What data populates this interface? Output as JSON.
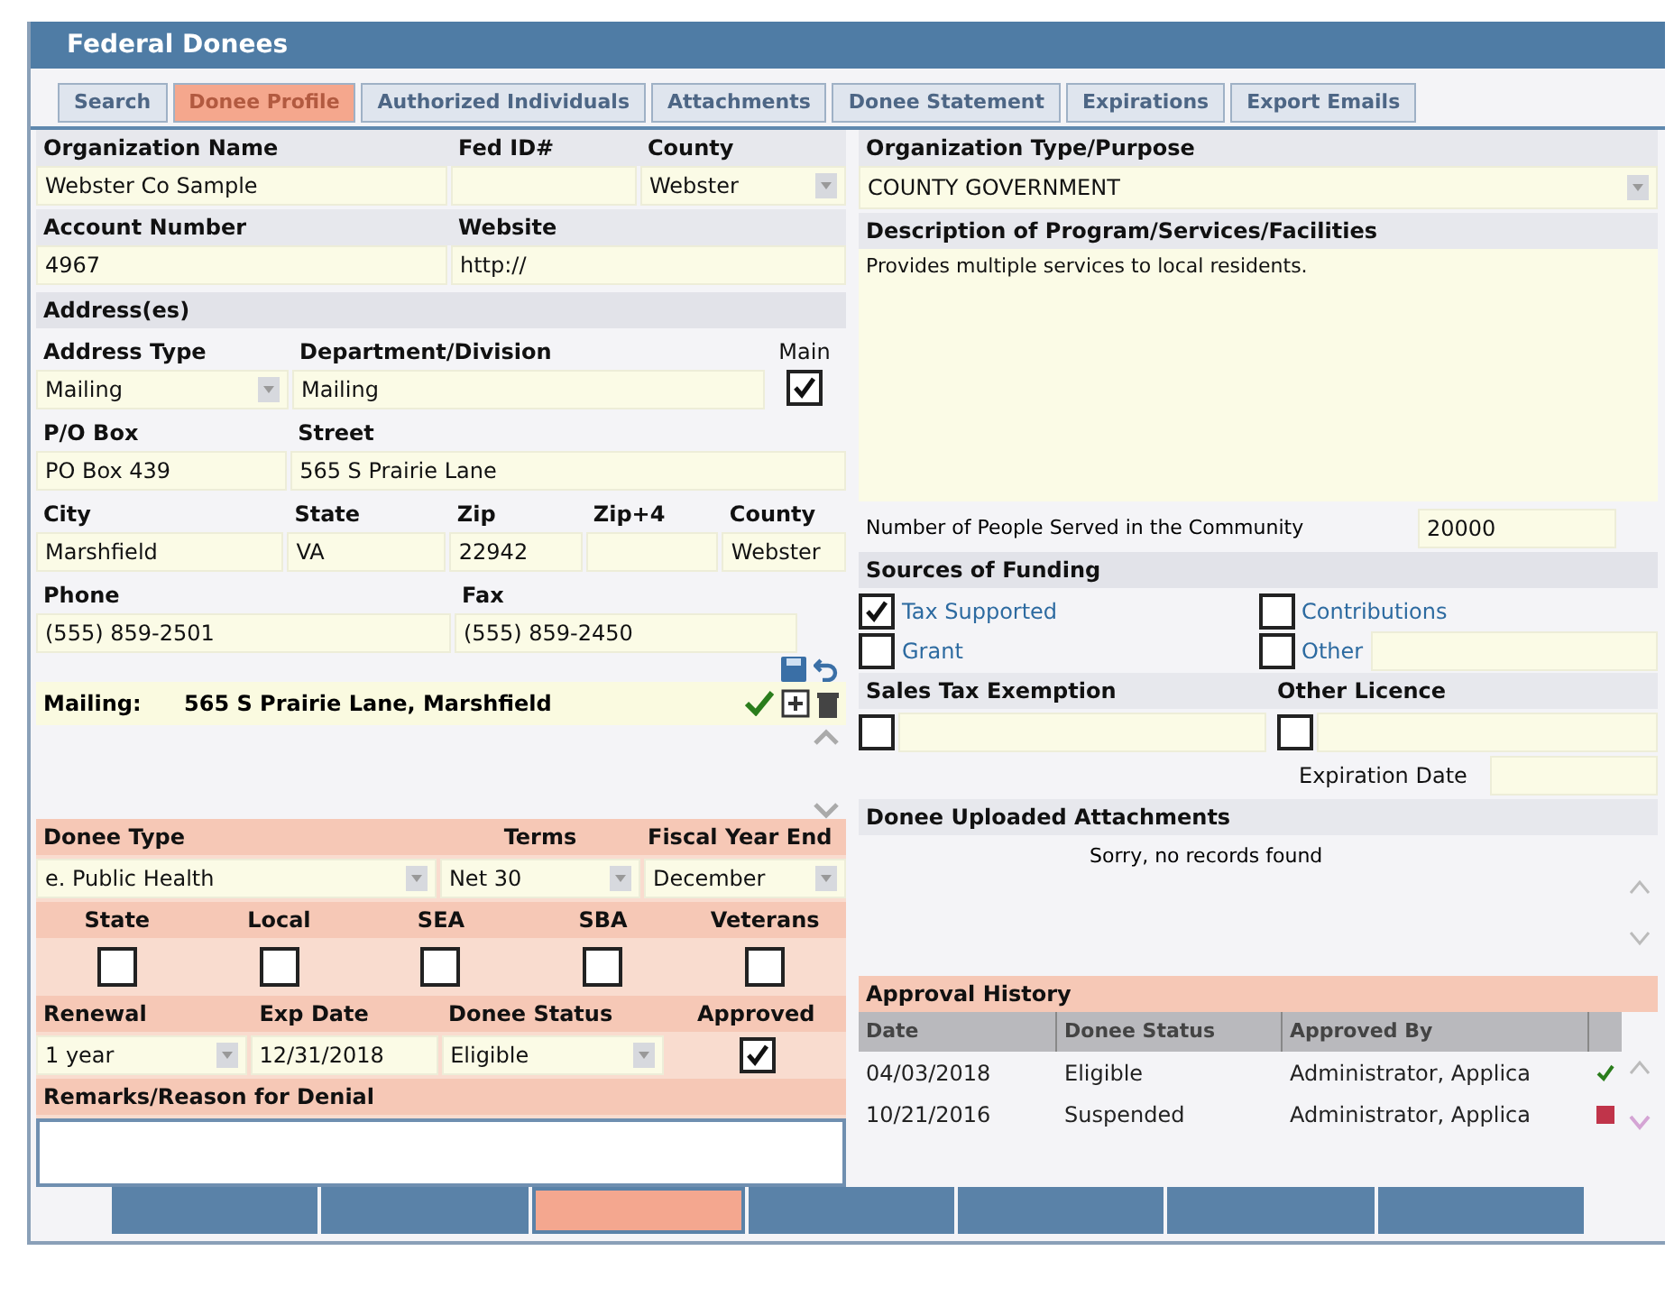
{
  "window": {
    "title": "Federal Donees"
  },
  "tabs": [
    {
      "label": "Search",
      "selected": false
    },
    {
      "label": "Donee Profile",
      "selected": true
    },
    {
      "label": "Authorized Individuals",
      "selected": false
    },
    {
      "label": "Attachments",
      "selected": false
    },
    {
      "label": "Donee Statement",
      "selected": false
    },
    {
      "label": "Expirations",
      "selected": false
    },
    {
      "label": "Export Emails",
      "selected": false
    }
  ],
  "organization": {
    "name_label": "Organization Name",
    "name": "Webster Co Sample",
    "fed_id_label": "Fed ID#",
    "county_label": "County",
    "county": "Webster",
    "account_label": "Account Number",
    "account": "4967",
    "website_label": "Website",
    "website": "http://"
  },
  "address": {
    "heading": "Address(es)",
    "rows": [
      [
        {
          "label": "Address Type",
          "value": "Mailing",
          "kind": "select"
        },
        {
          "label": "Department/Division",
          "value": "Mailing",
          "kind": "text"
        }
      ],
      [
        {
          "label": "P/O Box",
          "value": "PO Box 439",
          "kind": "text"
        },
        {
          "label": "Street",
          "value": "565 S Prairie Lane",
          "kind": "text"
        }
      ],
      [
        {
          "label": "City",
          "value": "Marshfield",
          "kind": "text"
        },
        {
          "label": "State",
          "value": "VA",
          "kind": "text"
        },
        {
          "label": "Zip",
          "value": "22942",
          "kind": "text"
        },
        {
          "label": "Zip+4",
          "kind": "text"
        },
        {
          "label": "County",
          "value": "Webster",
          "kind": "text"
        }
      ],
      [
        {
          "label": "Phone",
          "value": "(555) 859-2501",
          "kind": "text"
        },
        {
          "label": "Fax",
          "value": "(555) 859-2450",
          "kind": "text"
        }
      ]
    ],
    "main": {
      "label": "Main",
      "checked": true
    },
    "mailing": {
      "label": "Mailing:",
      "value": "565 S Prairie Lane, Marshfield",
      "verified": true
    }
  },
  "donee": {
    "type_label": "Donee Type",
    "type": "e. Public Health",
    "terms_label": "Terms",
    "terms": "Net 30",
    "fiscal_label": "Fiscal Year End",
    "fiscal": "December",
    "programs": [
      {
        "label": "State",
        "checked": false
      },
      {
        "label": "Local",
        "checked": false
      },
      {
        "label": "SEA",
        "checked": false
      },
      {
        "label": "SBA",
        "checked": false
      },
      {
        "label": "Veterans",
        "checked": false
      }
    ],
    "renewal_label": "Renewal",
    "renewal": "1 year",
    "exp_label": "Exp Date",
    "exp": "12/31/2018",
    "status_label": "Donee Status",
    "status": "Eligible",
    "approved_label": "Approved",
    "approved": true,
    "remarks_label": "Remarks/Reason for Denial"
  },
  "org_type": {
    "label": "Organization Type/Purpose",
    "value": "COUNTY GOVERNMENT"
  },
  "description": {
    "label": "Description of Program/Services/Facilities",
    "value": "Provides multiple services to local residents."
  },
  "people_served": {
    "label": "Number of People Served in the Community",
    "value": "20000"
  },
  "funding": {
    "heading": "Sources of Funding",
    "options": [
      {
        "label": "Tax Supported",
        "checked": true
      },
      {
        "label": "Contributions",
        "checked": false
      },
      {
        "label": "Grant",
        "checked": false
      },
      {
        "label": "Other",
        "checked": false
      }
    ]
  },
  "sales_tax": {
    "label": "Sales Tax Exemption",
    "checked": false
  },
  "other_licence": {
    "label": "Other Licence",
    "checked": false,
    "expiration_label": "Expiration Date"
  },
  "attachments": {
    "heading": "Donee Uploaded Attachments",
    "empty": "Sorry, no records found"
  },
  "approval": {
    "heading": "Approval History",
    "columns": [
      "Date",
      "Donee Status",
      "Approved By"
    ],
    "rows": [
      {
        "date": "04/03/2018",
        "status": "Eligible",
        "approved_by": "Administrator, Applica",
        "kind": "approved"
      },
      {
        "date": "10/21/2016",
        "status": "Suspended",
        "approved_by": "Administrator, Applica",
        "kind": "rejected"
      }
    ]
  },
  "footer_buttons": [
    {
      "highlighted": false
    },
    {
      "highlighted": false
    },
    {
      "highlighted": true
    },
    {
      "highlighted": false
    },
    {
      "highlighted": false
    },
    {
      "highlighted": false
    },
    {
      "highlighted": false
    }
  ]
}
